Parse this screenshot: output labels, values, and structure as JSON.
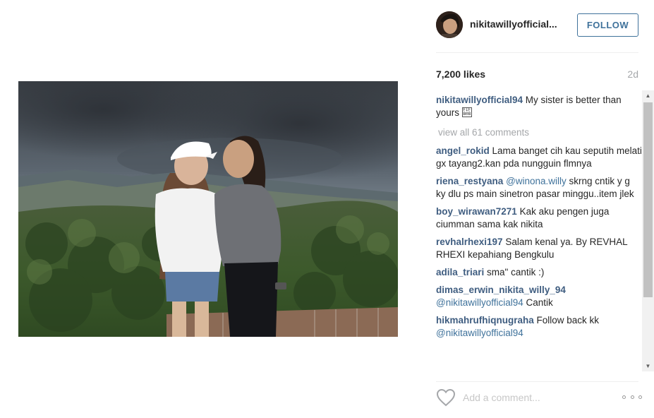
{
  "post": {
    "author": "nikitawillyofficial...",
    "follow_label": "FOLLOW",
    "likes": "7,200 likes",
    "time_ago": "2d"
  },
  "caption": {
    "user": "nikitawillyofficial94",
    "text": " My sister is better than yours ",
    "glyph": "FIF\nB0B"
  },
  "view_all": "view all 61 comments",
  "comments": [
    {
      "user": "angel_rokid",
      "text": " Lama banget cih kau seputih melati gx tayang2.kan pda nungguin flmnya"
    },
    {
      "user": "riena_restyana",
      "mention": " @winona.willy",
      "text": " skrng cntik y g ky dlu ps main sinetron pasar minggu..item jlek"
    },
    {
      "user": "boy_wirawan7271",
      "text": " Kak aku pengen juga ciumman sama kak nikita"
    },
    {
      "user": "revhalrhexi197",
      "text": " Salam kenal ya. By REVHAL RHEXI kepahiang Bengkulu"
    },
    {
      "user": "adila_triari",
      "text": " sma\" cantik :)"
    },
    {
      "user": "dimas_erwin_nikita_willy_94",
      "mention": " @nikitawillyofficial94",
      "text": " Cantik"
    },
    {
      "user": "hikmahrufhiqnugraha",
      "text": " Follow back kk ",
      "mention2": "@nikitawillyofficial94"
    }
  ],
  "footer": {
    "comment_placeholder": "Add a comment...",
    "like_icon": "heart-icon",
    "more_icon": "more-options-icon"
  },
  "colors": {
    "accent": "#3f729b",
    "username": "#3f5d80",
    "muted": "#a5a7aa"
  }
}
